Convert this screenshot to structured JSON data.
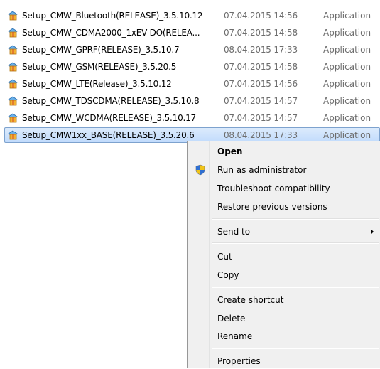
{
  "files": [
    {
      "name": "Setup_CMW_Bluetooth(RELEASE)_3.5.10.12",
      "date": "07.04.2015 14:56",
      "type": "Application",
      "selected": false
    },
    {
      "name": "Setup_CMW_CDMA2000_1xEV-DO(RELEA...",
      "date": "07.04.2015 14:58",
      "type": "Application",
      "selected": false
    },
    {
      "name": "Setup_CMW_GPRF(RELEASE)_3.5.10.7",
      "date": "08.04.2015 17:33",
      "type": "Application",
      "selected": false
    },
    {
      "name": "Setup_CMW_GSM(RELEASE)_3.5.20.5",
      "date": "07.04.2015 14:58",
      "type": "Application",
      "selected": false
    },
    {
      "name": "Setup_CMW_LTE(Release)_3.5.10.12",
      "date": "07.04.2015 14:56",
      "type": "Application",
      "selected": false
    },
    {
      "name": "Setup_CMW_TDSCDMA(RELEASE)_3.5.10.8",
      "date": "07.04.2015 14:57",
      "type": "Application",
      "selected": false
    },
    {
      "name": "Setup_CMW_WCDMA(RELEASE)_3.5.10.17",
      "date": "07.04.2015 14:57",
      "type": "Application",
      "selected": false
    },
    {
      "name": "Setup_CMW1xx_BASE(RELEASE)_3.5.20.6",
      "date": "08.04.2015 17:33",
      "type": "Application",
      "selected": true
    }
  ],
  "file_icon": "installer-icon",
  "context_menu": {
    "open": "Open",
    "run_as_admin": "Run as administrator",
    "run_as_admin_icon": "uac-shield-icon",
    "troubleshoot": "Troubleshoot compatibility",
    "restore": "Restore previous versions",
    "send_to": "Send to",
    "cut": "Cut",
    "copy": "Copy",
    "create_shortcut": "Create shortcut",
    "delete": "Delete",
    "rename": "Rename",
    "properties": "Properties"
  },
  "colors": {
    "selection": "#c1dbfc",
    "selection_border": "#7da2ce",
    "menu_background": "#f0f0f0",
    "secondary_text": "#6d6d6d"
  }
}
